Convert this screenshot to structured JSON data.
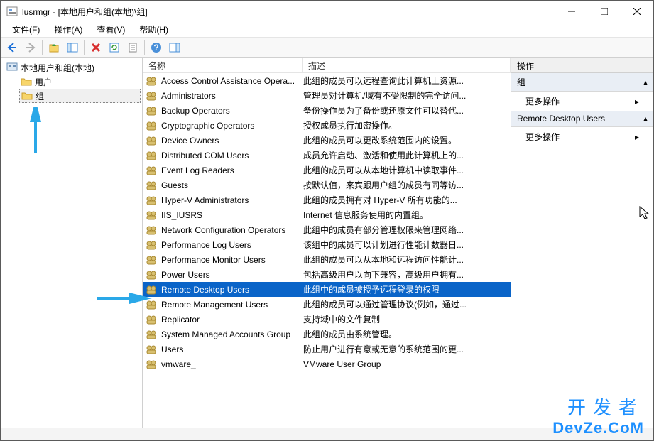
{
  "title": "lusrmgr - [本地用户和组(本地)\\组]",
  "menu": {
    "file": "文件(F)",
    "action": "操作(A)",
    "view": "查看(V)",
    "help": "帮助(H)"
  },
  "tree": {
    "root": "本地用户和组(本地)",
    "users": "用户",
    "groups": "组"
  },
  "columns": {
    "name": "名称",
    "desc": "描述"
  },
  "groups": [
    {
      "name": "Access Control Assistance Opera...",
      "desc": "此组的成员可以远程查询此计算机上资源...",
      "sel": false
    },
    {
      "name": "Administrators",
      "desc": "管理员对计算机/域有不受限制的完全访问...",
      "sel": false
    },
    {
      "name": "Backup Operators",
      "desc": "备份操作员为了备份或还原文件可以替代...",
      "sel": false
    },
    {
      "name": "Cryptographic Operators",
      "desc": "授权成员执行加密操作。",
      "sel": false
    },
    {
      "name": "Device Owners",
      "desc": "此组的成员可以更改系统范围内的设置。",
      "sel": false
    },
    {
      "name": "Distributed COM Users",
      "desc": "成员允许启动、激活和使用此计算机上的...",
      "sel": false
    },
    {
      "name": "Event Log Readers",
      "desc": "此组的成员可以从本地计算机中读取事件...",
      "sel": false
    },
    {
      "name": "Guests",
      "desc": "按默认值，来宾跟用户组的成员有同等访...",
      "sel": false
    },
    {
      "name": "Hyper-V Administrators",
      "desc": "此组的成员拥有对 Hyper-V 所有功能的...",
      "sel": false
    },
    {
      "name": "IIS_IUSRS",
      "desc": "Internet 信息服务使用的内置组。",
      "sel": false
    },
    {
      "name": "Network Configuration Operators",
      "desc": "此组中的成员有部分管理权限来管理网络...",
      "sel": false
    },
    {
      "name": "Performance Log Users",
      "desc": "该组中的成员可以计划进行性能计数器日...",
      "sel": false
    },
    {
      "name": "Performance Monitor Users",
      "desc": "此组的成员可以从本地和远程访问性能计...",
      "sel": false
    },
    {
      "name": "Power Users",
      "desc": "包括高级用户以向下兼容，高级用户拥有...",
      "sel": false
    },
    {
      "name": "Remote Desktop Users",
      "desc": "此组中的成员被授予远程登录的权限",
      "sel": true
    },
    {
      "name": "Remote Management Users",
      "desc": "此组的成员可以通过管理协议(例如，通过...",
      "sel": false
    },
    {
      "name": "Replicator",
      "desc": "支持域中的文件复制",
      "sel": false
    },
    {
      "name": "System Managed Accounts Group",
      "desc": "此组的成员由系统管理。",
      "sel": false
    },
    {
      "name": "Users",
      "desc": "防止用户进行有意或无意的系统范围的更...",
      "sel": false
    },
    {
      "name": "  vmware_",
      "desc": "VMware User Group",
      "sel": false
    }
  ],
  "actions": {
    "header": "操作",
    "section1": "组",
    "more": "更多操作",
    "section2": "Remote Desktop Users"
  },
  "watermark": {
    "line1": "开发者",
    "line2": "DevZe.CoM"
  }
}
